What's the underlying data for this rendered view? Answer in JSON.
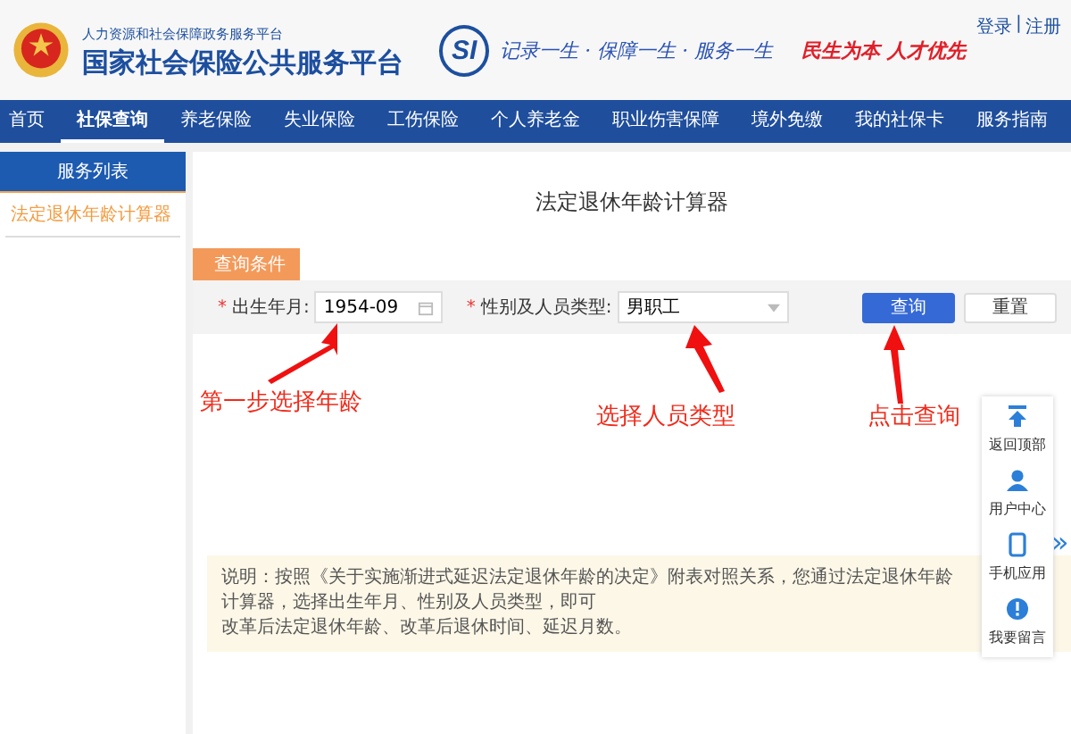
{
  "header": {
    "subtitle": "人力资源和社会保障政务服务平台",
    "title": "国家社会保险公共服务平台",
    "logo_text": "SI",
    "slogan": "记录一生 · 保障一生 · 服务一生",
    "motto": "民生为本 人才优先",
    "login": "登录",
    "separator": "|",
    "register": "注册"
  },
  "nav": [
    {
      "label": "首页",
      "selected": false
    },
    {
      "label": "社保查询",
      "selected": true
    },
    {
      "label": "养老保险",
      "selected": false
    },
    {
      "label": "失业保险",
      "selected": false
    },
    {
      "label": "工伤保险",
      "selected": false
    },
    {
      "label": "个人养老金",
      "selected": false
    },
    {
      "label": "职业伤害保障",
      "selected": false
    },
    {
      "label": "境外免缴",
      "selected": false
    },
    {
      "label": "我的社保卡",
      "selected": false
    },
    {
      "label": "服务指南",
      "selected": false
    }
  ],
  "sidebar": {
    "title": "服务列表",
    "items": [
      {
        "label": "法定退休年龄计算器",
        "selected": true
      }
    ]
  },
  "main": {
    "title": "法定退休年龄计算器",
    "section": "查询条件",
    "fields": [
      {
        "kind": "date",
        "required_mark": "*",
        "label": "出生年月:",
        "value": "1954-09"
      },
      {
        "kind": "select",
        "required_mark": "*",
        "label": "性别及人员类型:",
        "value": "男职工"
      }
    ],
    "buttons": [
      {
        "label": "查询",
        "kind": "primary"
      },
      {
        "label": "重置",
        "kind": "default"
      }
    ],
    "note": "说明：按照《关于实施渐进式延迟法定退休年龄的决定》附表对照关系，您通过法定退休年龄计算器，选择出生年月、性别及人员类型，即可",
    "note_line2": "改革后法定退休年龄、改革后退休时间、延迟月数。"
  },
  "annotations": [
    "第一步选择年龄",
    "选择人员类型",
    "点击查询"
  ],
  "float_panel": [
    "返回顶部",
    "用户中心",
    "手机应用",
    "我要留言"
  ],
  "expand": "»"
}
